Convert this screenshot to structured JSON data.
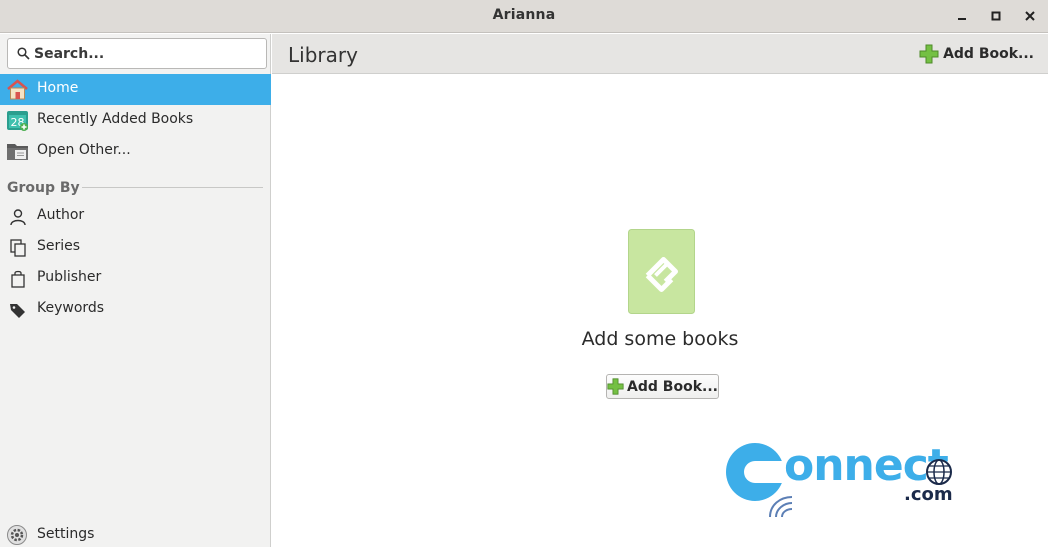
{
  "window": {
    "title": "Arianna"
  },
  "sidebar": {
    "search": {
      "placeholder": "Search...",
      "value": ""
    },
    "items": [
      {
        "label": "Home",
        "icon": "home-icon",
        "active": true
      },
      {
        "label": "Recently Added Books",
        "icon": "calendar-icon",
        "active": false
      },
      {
        "label": "Open Other...",
        "icon": "folder-icon",
        "active": false
      }
    ],
    "group_by": {
      "header": "Group By",
      "items": [
        {
          "label": "Author",
          "icon": "user-icon"
        },
        {
          "label": "Series",
          "icon": "copy-icon"
        },
        {
          "label": "Publisher",
          "icon": "bag-icon"
        },
        {
          "label": "Keywords",
          "icon": "tag-icon"
        }
      ]
    },
    "settings": {
      "label": "Settings",
      "icon": "gear-icon"
    }
  },
  "main": {
    "title": "Library",
    "header_add_label": "Add Book...",
    "empty": {
      "title": "Add some books",
      "add_label": "Add Book..."
    }
  },
  "colors": {
    "accent": "#3daee9",
    "book_icon_bg": "#c8e6a0",
    "add_green": "#74c043"
  }
}
